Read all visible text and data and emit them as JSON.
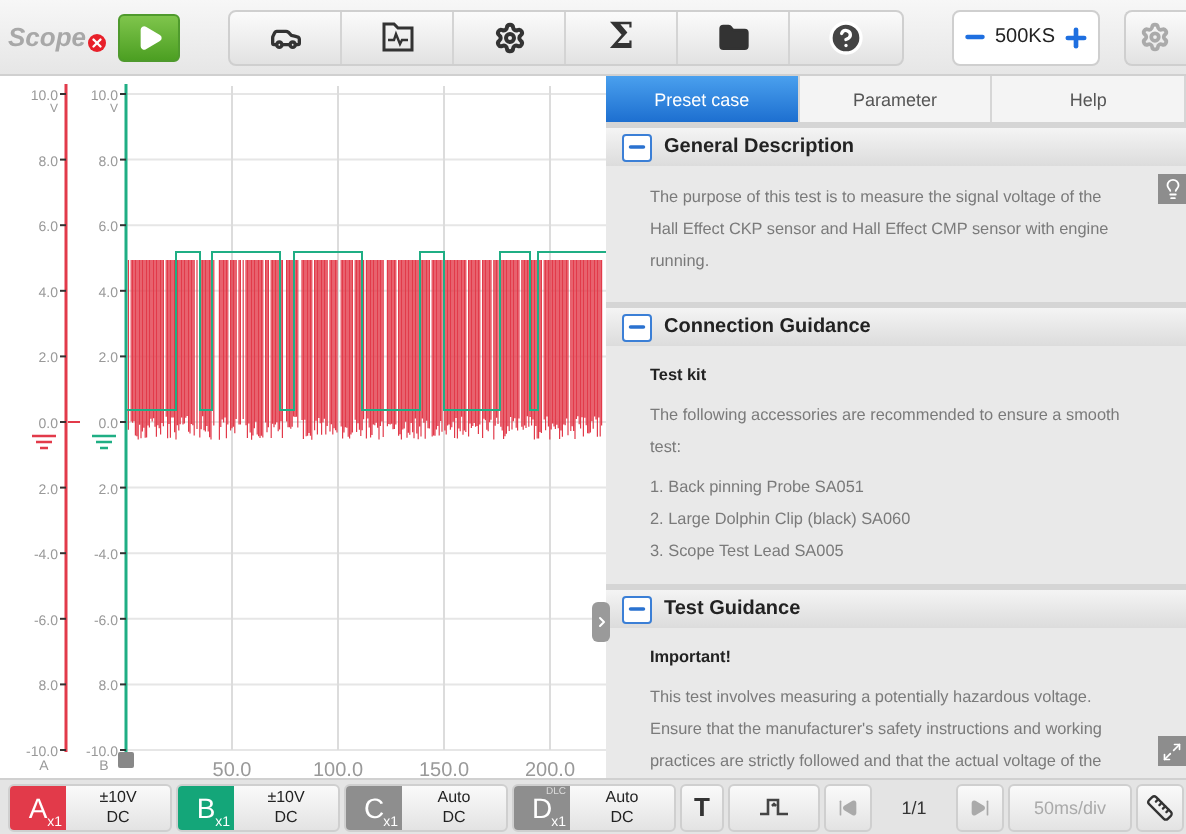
{
  "app": {
    "title": "Scope",
    "error": true
  },
  "toolbar": [
    {
      "kind": "car"
    },
    {
      "kind": "waveform-file"
    },
    {
      "kind": "settings"
    },
    {
      "kind": "sum",
      "label": "Σ"
    },
    {
      "kind": "folder"
    },
    {
      "kind": "help"
    }
  ],
  "sample_rate": {
    "value": "500KS"
  },
  "settings_disabled": true,
  "scope": {
    "axis_a": {
      "name": "A",
      "unit": "V",
      "labels": [
        "10.0",
        "8.0",
        "6.0",
        "4.0",
        "2.0",
        "0.0",
        "2.0",
        "-4.0",
        "-6.0",
        "8.0",
        "-10.0"
      ]
    },
    "axis_b": {
      "name": "B",
      "unit": "V",
      "labels": [
        "10.0",
        "8.0",
        "6.0",
        "4.0",
        "2.0",
        "0.0",
        "2.0",
        "-4.0",
        "-6.0",
        "8.0",
        "-10.0"
      ]
    },
    "x_labels": [
      "50.0",
      "100.0",
      "150.0",
      "200.0"
    ]
  },
  "tabs": [
    {
      "label": "Preset case",
      "selected": true
    },
    {
      "label": "Parameter",
      "selected": false
    },
    {
      "label": "Help",
      "selected": false
    }
  ],
  "sections": [
    {
      "title": "General Description",
      "expanded": true,
      "blocks": [
        {
          "kind": "para",
          "text": "The purpose of this test is to measure the signal voltage of the Hall Effect CKP sensor and Hall Effect CMP sensor with engine running."
        }
      ]
    },
    {
      "title": "Connection Guidance",
      "expanded": true,
      "blocks": [
        {
          "kind": "heading",
          "text": "Test kit"
        },
        {
          "kind": "para",
          "text": "The following accessories are recommended to ensure a smooth test:"
        },
        {
          "kind": "item",
          "text": "1. Back pinning Probe SA051"
        },
        {
          "kind": "item",
          "text": "2. Large Dolphin Clip (black) SA060"
        },
        {
          "kind": "item",
          "text": "3. Scope Test Lead SA005"
        }
      ]
    },
    {
      "title": "Test Guidance",
      "expanded": true,
      "blocks": [
        {
          "kind": "heading",
          "text": "Important!"
        },
        {
          "kind": "para",
          "text": "This test involves measuring a potentially hazardous voltage. Ensure that the manufacturer's safety instructions and working practices are strictly followed and that the actual voltage of the"
        }
      ]
    }
  ],
  "channels": [
    {
      "letter": "A",
      "probe": "x1",
      "range": "±10V",
      "coupling": "DC",
      "color": "#e23a4a"
    },
    {
      "letter": "B",
      "probe": "x1",
      "range": "±10V",
      "coupling": "DC",
      "color": "#14a679"
    },
    {
      "letter": "C",
      "probe": "x1",
      "range": "Auto",
      "coupling": "DC",
      "color": "#8e8e8e"
    },
    {
      "letter": "D",
      "badge": "DLC",
      "probe": "x1",
      "range": "Auto",
      "coupling": "DC",
      "color": "#8e8e8e"
    }
  ],
  "trigger": {
    "label": "T"
  },
  "pager": {
    "text": "1/1",
    "prev_disabled": true,
    "next_disabled": true
  },
  "timebase": {
    "value": "50ms/div",
    "disabled": true
  }
}
